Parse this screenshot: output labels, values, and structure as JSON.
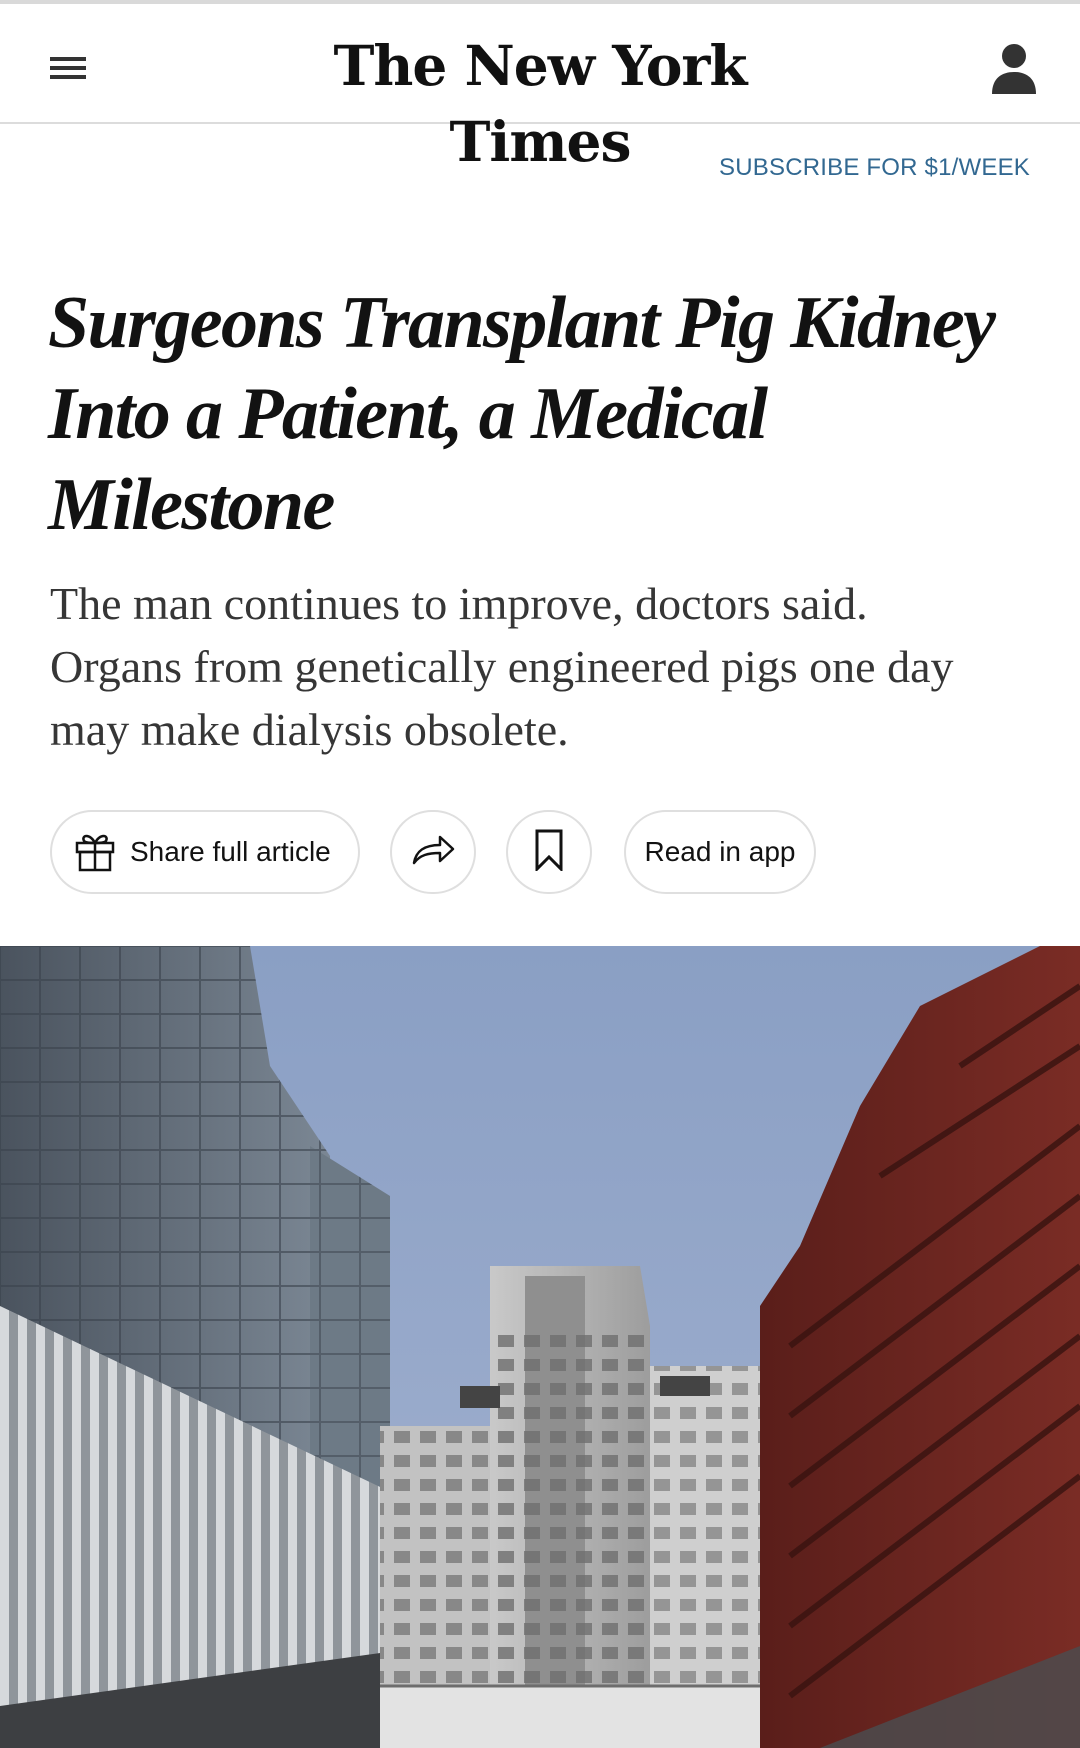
{
  "header": {
    "logo_text": "The New York Times",
    "menu_icon": "menu-icon",
    "account_icon": "account-icon"
  },
  "subscribe": {
    "label": "SUBSCRIBE FOR $1/WEEK",
    "color": "#326891"
  },
  "article": {
    "headline_lines": [
      "Surgeons Transplant Pig Kidney",
      "Into a Patient, a Medical",
      "Milestone"
    ],
    "summary_lines": [
      "The man continues to improve, doctors said.",
      "Organs from genetically engineered pigs one day",
      "may make dialysis obsolete."
    ]
  },
  "actions": {
    "share_full_article": "Share full article",
    "gift_icon": "gift-icon",
    "share_icon": "share-arrow-icon",
    "bookmark_icon": "bookmark-icon",
    "read_in_app": "Read in app"
  },
  "hero": {
    "icon": "hospital-buildings-photo",
    "colors": {
      "sky": "#8fa3c7",
      "glass_building": "#5d6773",
      "center_tower": "#b9b9b9",
      "brick_building": "#6b2520"
    }
  }
}
